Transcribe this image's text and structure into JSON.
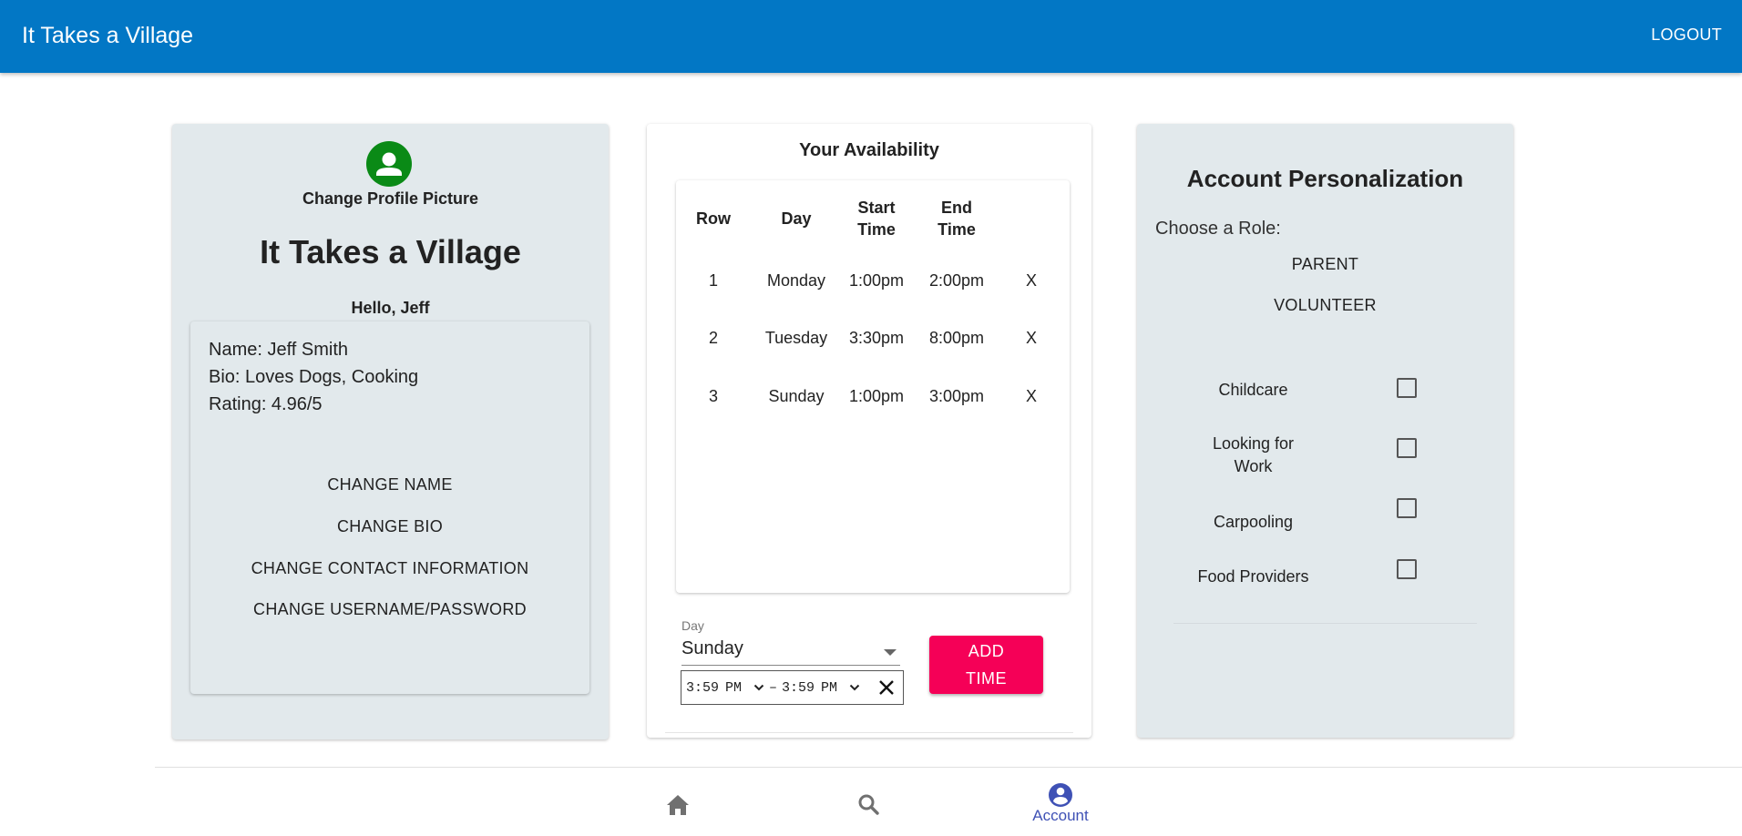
{
  "appbar": {
    "title": "It Takes a Village",
    "logout": "LOGOUT"
  },
  "profile": {
    "change_picture": "Change Profile Picture",
    "heading": "It Takes a Village",
    "greeting": "Hello, Jeff",
    "name": "Name: Jeff Smith",
    "bio": "Bio: Loves Dogs, Cooking",
    "rating": "Rating: 4.96/5",
    "buttons": [
      "CHANGE NAME",
      "CHANGE BIO",
      "CHANGE CONTACT INFORMATION",
      "CHANGE USERNAME/PASSWORD"
    ]
  },
  "availability": {
    "title": "Your Availability",
    "headers": {
      "row": "Row",
      "day": "Day",
      "start_1": "Start",
      "start_2": "Time",
      "end_1": "End",
      "end_2": "Time"
    },
    "rows": [
      {
        "row": "1",
        "day": "Monday",
        "start": "1:00pm",
        "end": "2:00pm",
        "delete": "X"
      },
      {
        "row": "2",
        "day": "Tuesday",
        "start": "3:30pm",
        "end": "8:00pm",
        "delete": "X"
      },
      {
        "row": "3",
        "day": "Sunday",
        "start": "1:00pm",
        "end": "3:00pm",
        "delete": "X"
      }
    ],
    "day_label": "Day",
    "day_value": "Sunday",
    "time_start": "3:59",
    "time_start_ampm": "PM",
    "time_sep": "–",
    "time_end": "3:59",
    "time_end_ampm": "PM",
    "add_line1": "ADD",
    "add_line2": "TIME"
  },
  "account": {
    "title": "Account Personalization",
    "role_label": "Choose a Role:",
    "roles": [
      "PARENT",
      "VOLUNTEER"
    ],
    "preferences": [
      {
        "line1": "Childcare",
        "line2": "",
        "checked": false
      },
      {
        "line1": "Looking for",
        "line2": "Work",
        "checked": false
      },
      {
        "line1": "Carpooling",
        "line2": "",
        "checked": false
      },
      {
        "line1": "Food Providers",
        "line2": "",
        "checked": false
      }
    ]
  },
  "bottom_nav": {
    "items": [
      {
        "icon": "home-icon",
        "label": ""
      },
      {
        "icon": "search-icon",
        "label": ""
      },
      {
        "icon": "account-circle-icon",
        "label": "Account"
      }
    ],
    "active_color": "#3f51b5",
    "inactive_color": "#707070"
  },
  "colors": {
    "appbar": "#0277c5",
    "add_button": "#f50057",
    "avatar": "#0a8a16",
    "card_bg": "#e2e9ec"
  }
}
